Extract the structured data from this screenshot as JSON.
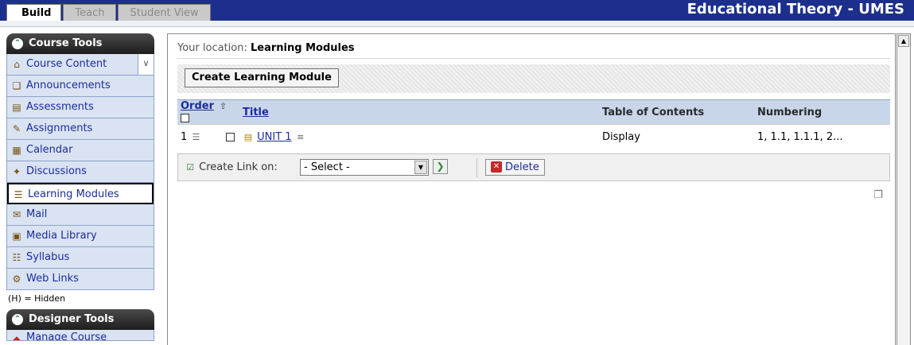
{
  "topbar": {
    "tabs": [
      "Build",
      "Teach",
      "Student View"
    ],
    "course_title": "Educational Theory - UMES"
  },
  "sidebar": {
    "course_tools_title": "Course Tools",
    "items": [
      {
        "label": "Course Content",
        "icon": "house-icon"
      },
      {
        "label": "Announcements",
        "icon": "megaphone-icon"
      },
      {
        "label": "Assessments",
        "icon": "assessment-icon"
      },
      {
        "label": "Assignments",
        "icon": "assignment-icon"
      },
      {
        "label": "Calendar",
        "icon": "calendar-icon"
      },
      {
        "label": "Discussions",
        "icon": "discussions-icon"
      },
      {
        "label": "Learning Modules",
        "icon": "learning-modules-icon"
      },
      {
        "label": "Mail",
        "icon": "mail-icon"
      },
      {
        "label": "Media Library",
        "icon": "media-library-icon"
      },
      {
        "label": "Syllabus",
        "icon": "syllabus-icon"
      },
      {
        "label": "Web Links",
        "icon": "web-links-icon"
      }
    ],
    "hidden_note": "(H) = Hidden",
    "designer_tools_title": "Designer Tools",
    "designer_items": [
      {
        "label": "Manage Course"
      }
    ]
  },
  "main": {
    "location_prefix": "Your location:",
    "location": "Learning Modules",
    "create_button": "Create Learning Module",
    "columns": [
      "Order",
      "Title",
      "Table of Contents",
      "Numbering"
    ],
    "rows": [
      {
        "order": "1",
        "title": "UNIT 1",
        "toc": "Display",
        "numbering": "1, 1.1, 1.1.1, 2..."
      }
    ],
    "create_link_label": "Create Link on:",
    "select_value": "- Select -",
    "delete_button": "Delete"
  }
}
